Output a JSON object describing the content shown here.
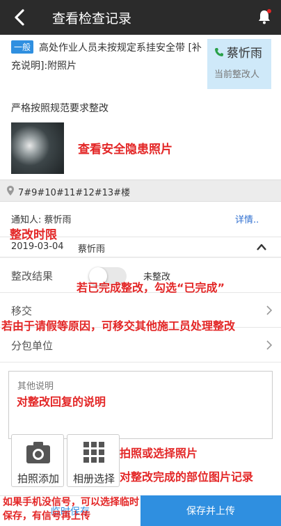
{
  "header": {
    "title": "查看检查记录",
    "back_icon": "back-chevron-icon",
    "bell_icon": "bell-icon"
  },
  "hazard": {
    "level_tag": "一般",
    "description_line1": "高处作业人员未按规定系挂安全带 [补",
    "description_line2": "充说明]:附照片",
    "requirement": "严格按照规范要求整改"
  },
  "rectifier": {
    "name": "蔡忻雨",
    "role": "当前整改人"
  },
  "location": {
    "text": "7#9#10#11#12#13#楼"
  },
  "notify": {
    "label": "通知人: 蔡忻雨",
    "detail_link": "详情.."
  },
  "deadline": {
    "date": "2019-03-04",
    "name": "蔡忻雨"
  },
  "form": {
    "result_label": "整改结果",
    "result_toggle_on": false,
    "result_value": "未整改",
    "transfer_label": "移交",
    "subcontract_label": "分包单位",
    "other_note_placeholder": "其他说明"
  },
  "media_buttons": {
    "camera_label": "拍照添加",
    "album_label": "相册选择"
  },
  "bottom_bar": {
    "temp_save": "临时保存",
    "save_upload": "保存并上传"
  },
  "annotations": {
    "photo_hint": "查看安全隐患照片",
    "deadline_hint": "整改时限",
    "complete_hint": "若已完成整改，勾选“已完成”",
    "transfer_hint": "若由于请假等原因，可移交其他施工员处理整改",
    "note_hint": "对整改回复的说明",
    "media_hint1": "拍照或选择照片",
    "media_hint2": "对整改完成的部位图片记录",
    "offline_hint": "如果手机没信号，可以选择临时保存，有信号再上传"
  },
  "colors": {
    "header_bg": "#2b2b2b",
    "accent_blue": "#2f8fe0",
    "annotation_red": "#e32626",
    "rectifier_box_bg": "#cfe9f9"
  }
}
